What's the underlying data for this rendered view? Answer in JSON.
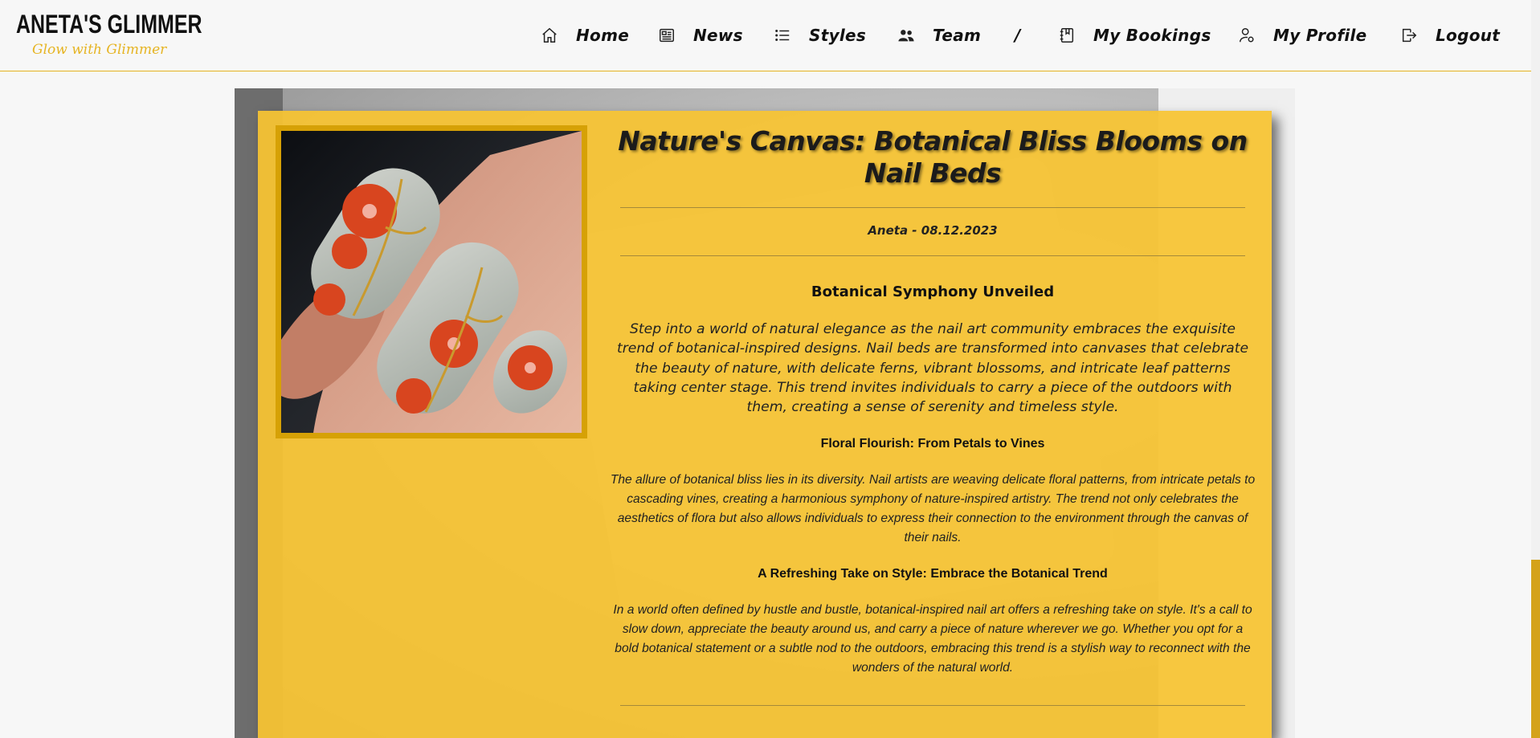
{
  "brand": {
    "name": "ANETA'S GLIMMER",
    "tagline": "Glow with Glimmer"
  },
  "nav": {
    "items": [
      {
        "label": "Home",
        "icon": "home-icon"
      },
      {
        "label": "News",
        "icon": "newspaper-icon"
      },
      {
        "label": "Styles",
        "icon": "list-icon"
      },
      {
        "label": "Team",
        "icon": "users-icon"
      },
      {
        "label": "My Bookings",
        "icon": "journal-icon"
      },
      {
        "label": "My Profile",
        "icon": "user-gear-icon"
      },
      {
        "label": "Logout",
        "icon": "logout-icon"
      }
    ],
    "separator": "/"
  },
  "article": {
    "title": "Nature's Canvas: Botanical Bliss Blooms on Nail Beds",
    "meta": "Aneta - 08.12.2023",
    "sections": [
      {
        "heading": "Botanical Symphony Unveiled",
        "body": "Step into a world of natural elegance as the nail art community embraces the exquisite trend of botanical-inspired designs. Nail beds are transformed into canvases that celebrate the beauty of nature, with delicate ferns, vibrant blossoms, and intricate leaf patterns taking center stage. This trend invites individuals to carry a piece of the outdoors with them, creating a sense of serenity and timeless style."
      },
      {
        "heading": "Floral Flourish: From Petals to Vines",
        "body": "The allure of botanical bliss lies in its diversity. Nail artists are weaving delicate floral patterns, from intricate petals to cascading vines, creating a harmonious symphony of nature-inspired artistry. The trend not only celebrates the aesthetics of flora but also allows individuals to express their connection to the environment through the canvas of their nails."
      },
      {
        "heading": "A Refreshing Take on Style: Embrace the Botanical Trend",
        "body": "In a world often defined by hustle and bustle, botanical-inspired nail art offers a refreshing take on style. It's a call to slow down, appreciate the beauty around us, and carry a piece of nature wherever we go. Whether you opt for a bold botanical statement or a subtle nod to the outdoors, embracing this trend is a stylish way to reconnect with the wonders of the natural world."
      }
    ]
  },
  "colors": {
    "accent": "#f7c432",
    "frame": "#d6a106",
    "text": "#1b1b1b"
  }
}
